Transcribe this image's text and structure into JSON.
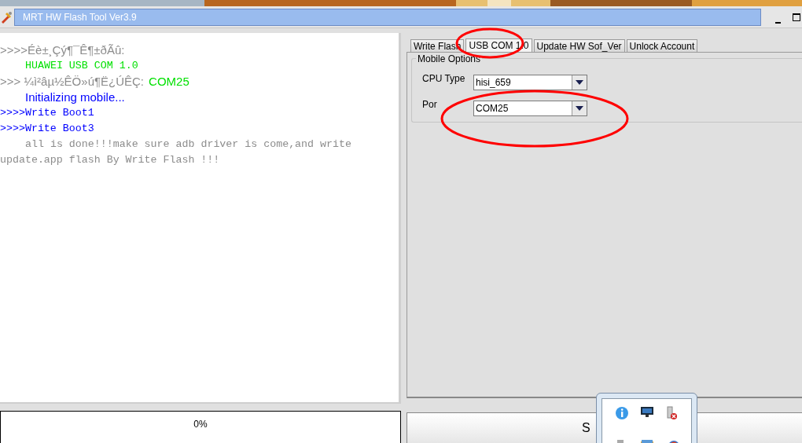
{
  "window": {
    "title": "MRT HW Flash Tool Ver3.9"
  },
  "log": [
    {
      "kind": "sans",
      "indent": false,
      "segments": [
        {
          "text": ">>>>Éè±¸Çý¶¯Ê¶±ðÃû:",
          "color": "#8c8c8c"
        }
      ]
    },
    {
      "kind": "mono",
      "indent": true,
      "segments": [
        {
          "text": "HUAWEI USB COM 1.0",
          "color": "#00e000"
        }
      ]
    },
    {
      "kind": "sans",
      "indent": false,
      "segments": [
        {
          "text": ">>> ¼ì²âµ½ÊÖ»ú¶Ë¿ÚÊÇ:",
          "color": "#8c8c8c"
        },
        {
          "text": "COM25",
          "color": "#00e000"
        }
      ]
    },
    {
      "kind": "sans",
      "indent": true,
      "segments": [
        {
          "text": "Initializing mobile...",
          "color": "#0000ff"
        }
      ]
    },
    {
      "kind": "mono",
      "indent": false,
      "segments": [
        {
          "text": ">>>>Write Boot1",
          "color": "#0000ff"
        }
      ]
    },
    {
      "kind": "mono",
      "indent": false,
      "segments": [
        {
          "text": ">>>>Write Boot3",
          "color": "#0000ff"
        }
      ]
    },
    {
      "kind": "mono",
      "indent": true,
      "segments": [
        {
          "text": "all is done!!!make sure adb driver is come,and write update.app flash By Write Flash !!!",
          "color": "#8c8c8c"
        }
      ]
    }
  ],
  "tabs": [
    {
      "label": "Write Flash",
      "selected": false
    },
    {
      "label": "USB COM 1.0",
      "selected": true
    },
    {
      "label": "Update HW Sof_Ver",
      "selected": false
    },
    {
      "label": "Unlock Account",
      "selected": false
    }
  ],
  "mobile_options": {
    "title": "Mobile Options",
    "fields": [
      {
        "label": "CPU Type",
        "value": "hisi_659"
      },
      {
        "label": "Por",
        "value": "COM25"
      }
    ]
  },
  "progress": {
    "level": 0,
    "text": "0%"
  },
  "start_button": {
    "label": "S"
  }
}
